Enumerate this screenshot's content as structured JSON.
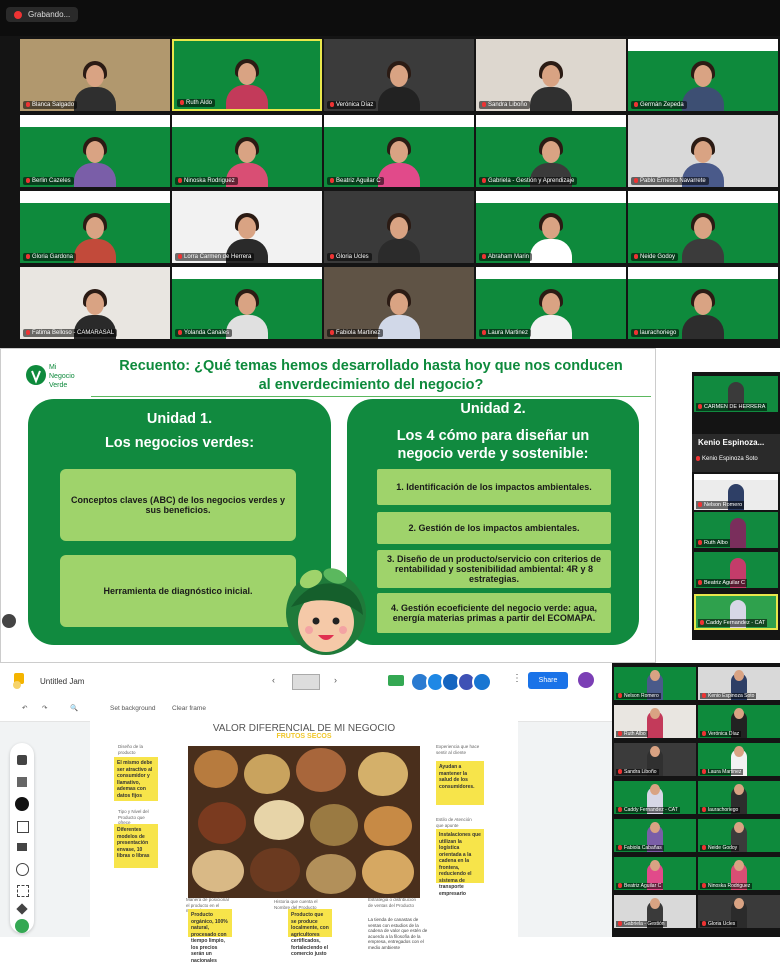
{
  "recording": {
    "label": "Grabando..."
  },
  "participants": [
    {
      "name": "Blanca Salgado"
    },
    {
      "name": "Ruth Aldo"
    },
    {
      "name": "Verónica Díaz"
    },
    {
      "name": "Sandra Liboño"
    },
    {
      "name": "Germán Zepeda"
    },
    {
      "name": "Berlin Cazeles"
    },
    {
      "name": "Ninoska Rodriguez"
    },
    {
      "name": "Beatriz Aguilar C"
    },
    {
      "name": "Gabriela - Gestión y Aprendizaje"
    },
    {
      "name": "Pablo Ernesto Navarrete"
    },
    {
      "name": "Gloria Gardona"
    },
    {
      "name": "Lorra Carmen de Herrera"
    },
    {
      "name": "Gloria Ucles"
    },
    {
      "name": "Abraham Marin"
    },
    {
      "name": "Neide Godoy"
    },
    {
      "name": "Fatima Belloso - CAMARASAL"
    },
    {
      "name": "Yolanda Canales"
    },
    {
      "name": "Fabiola Martinez"
    },
    {
      "name": "Laura Martinez"
    },
    {
      "name": "laurachoriego"
    }
  ],
  "slide": {
    "logo_line1": "Mi",
    "logo_line2": "Negocio",
    "logo_line3": "Verde",
    "title_line1": "Recuento: ¿Qué temas hemos desarrollado hasta hoy que nos conducen",
    "title_line2": "al enverdecimiento del negocio?",
    "unit1": {
      "heading": "Unidad 1.",
      "subheading": "Los negocios verdes:",
      "items": [
        "Conceptos claves (ABC) de los negocios verdes y sus beneficios.",
        "Herramienta de diagnóstico inicial."
      ]
    },
    "unit2": {
      "heading": "Unidad 2.",
      "subheading": "Los 4 cómo para diseñar un negocio verde y sostenible:",
      "items": [
        "1. Identificación de los impactos ambientales.",
        "2. Gestión de los impactos ambientales.",
        "3. Diseño de un producto/servicio con criterios de rentabilidad y sostenibilidad ambiental: 4R y 8 estrategias.",
        "4. Gestión ecoeficiente del negocio verde: agua, energía materias primas a partir del ECOMAPA."
      ]
    }
  },
  "side_panel": {
    "tiles": [
      {
        "name": "CARMEN DE HERRERA"
      },
      {
        "name": "Nelson Romero"
      },
      {
        "name": "Ruth Albo"
      },
      {
        "name": "Beatriz Aguilar C"
      },
      {
        "name": "Caddy Fernandez - CAT"
      }
    ],
    "speaker_name": "Kenio Espinoza...",
    "speaker_sub": "Kenio Espinoza Soto"
  },
  "jam": {
    "title": "Untitled Jam",
    "set_background": "Set background",
    "clear_frame": "Clear frame",
    "share_label": "Share",
    "board_title": "VALOR DIFERENCIAL DE MI NEGOCIO",
    "board_subtitle": "FRUTOS SECOS",
    "stickies": [
      "El mismo debe ser atractivo al consumidor y llamativo, ademas con datos fijos",
      "Diferentes modelos de presentación envase, 10 libras o libras",
      "Ayudan a mantener la salud de los consumidores.",
      "Instalaciones que utilizan la logística orientada a la cadena en la frontera, reduciendo el sistema de transporte empresario",
      "Producto orgánico, 100% natural, procesado con tiempo limpio, los precios serán un nacionales",
      "Producto que se produce localmente, con agricultores certificados, fortaleciendo el comercio justo",
      "La tienda de canastas de ventas con estudios de la cadena de valor que estén de acuerdo a la filosofía de la empresa, entregados con el medio ambiente"
    ],
    "labels": [
      "Diseño de la producto",
      "Tipo y Nivel del Producto que ofrece",
      "Experiencia que hace sentir al cliente",
      "Estilo de Atención que apunte",
      "Manera de posicionar el producto en el mercado",
      "Historia que cuenta el Nombre del Producto",
      "Estrategia o distribución de ventas del Producto"
    ]
  },
  "right_grid": [
    {
      "name": "Nelson Romero"
    },
    {
      "name": "Kenio Espinoza Soto"
    },
    {
      "name": "Ruth Albo"
    },
    {
      "name": "Verónica Díaz"
    },
    {
      "name": "Sandra Liboño"
    },
    {
      "name": "Laura Martinez"
    },
    {
      "name": "Caddy Fernandez - CAT"
    },
    {
      "name": "laurachoriego"
    },
    {
      "name": "Fabiola Cabañas"
    },
    {
      "name": "Neide Godoy"
    },
    {
      "name": "Beatriz Aguilar C"
    },
    {
      "name": "Ninoska Rodriguez"
    },
    {
      "name": "Gabriela - Gestión"
    },
    {
      "name": "Gloria Ucles"
    }
  ]
}
